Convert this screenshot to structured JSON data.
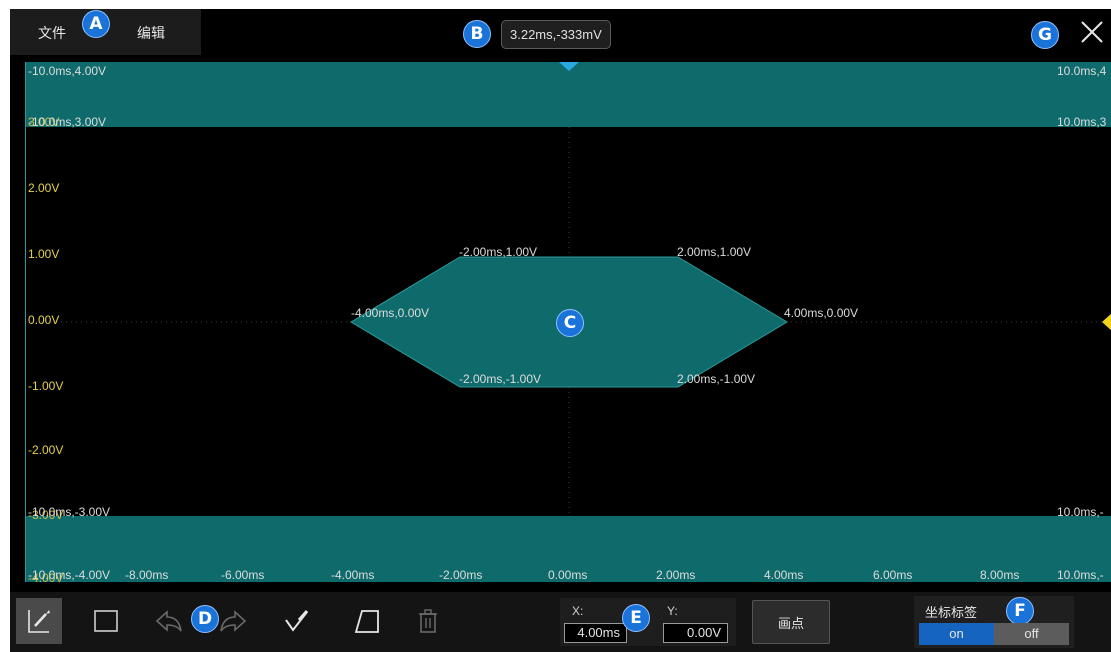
{
  "menu": {
    "file": "文件",
    "edit": "编辑"
  },
  "cursor_readout": "3.22ms,-333mV",
  "badges": {
    "a": "A",
    "b": "B",
    "c": "C",
    "d": "D",
    "e": "E",
    "f": "F",
    "g": "G"
  },
  "mask_bounds": {
    "top_left": "-10.0ms,4.00V",
    "top_right": "10.0ms,4",
    "upper_left": "-10.0ms,3.00V",
    "upper_right": "10.0ms,3",
    "lower_left": "-10.0ms,-3.00V",
    "lower_right": "10.0ms,-",
    "bottom_left": "-10.0ms,-4.00V",
    "bottom_right": "10.0ms,-"
  },
  "y_axis": {
    "overlap_top": "3.00V",
    "labels": [
      "2.00V",
      "1.00V",
      "0.00V",
      "-1.00V",
      "-2.00V"
    ],
    "overlap_low": "-3.00V",
    "overlap_bottom": "-4.00V"
  },
  "x_axis": {
    "labels": [
      "-8.00ms",
      "-6.00ms",
      "-4.00ms",
      "-2.00ms",
      "0.00ms",
      "2.00ms",
      "4.00ms",
      "6.00ms",
      "8.00ms"
    ]
  },
  "polygon_vertices": [
    {
      "label": "-4.00ms,0.00V",
      "t_ms": -4,
      "v": 0
    },
    {
      "label": "-2.00ms,1.00V",
      "t_ms": -2,
      "v": 1
    },
    {
      "label": "2.00ms,1.00V",
      "t_ms": 2,
      "v": 1
    },
    {
      "label": "4.00ms,0.00V",
      "t_ms": 4,
      "v": 0
    },
    {
      "label": "2.00ms,-1.00V",
      "t_ms": 2,
      "v": -1
    },
    {
      "label": "-2.00ms,-1.00V",
      "t_ms": -2,
      "v": -1
    }
  ],
  "toolbar": {
    "tools": [
      "pen-icon",
      "rectangle-icon",
      "undo-icon",
      "redo-icon",
      "node-edit-icon",
      "polygon-icon",
      "trash-icon"
    ],
    "x_label": "X:",
    "x_value": "4.00ms",
    "y_label": "Y:",
    "y_value": "0.00V",
    "draw_point": "画点",
    "coord_label_title": "坐标标签",
    "toggle_on": "on",
    "toggle_off": "off"
  },
  "colors": {
    "mask_fill": "#0f6b6b",
    "axis_label_yellow": "#e6d24a",
    "badge_blue": "#1a73d9",
    "toggle_on_blue": "#1565c0"
  }
}
